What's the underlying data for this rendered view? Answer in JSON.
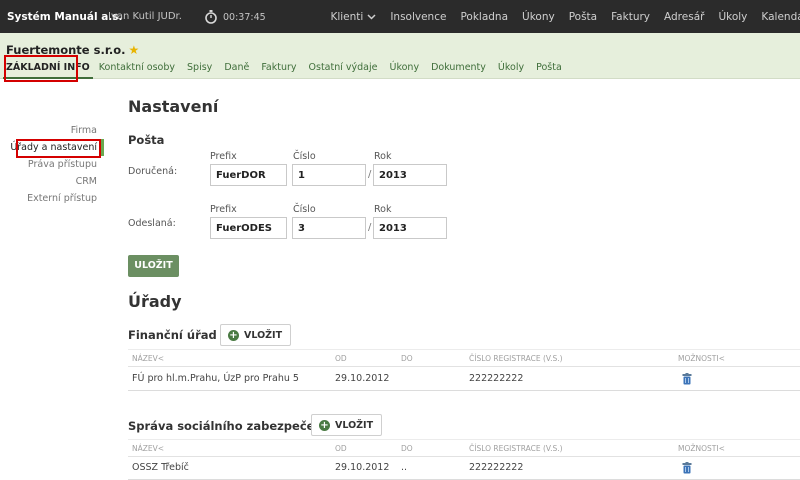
{
  "topbar": {
    "brand": "Systém Manuál a.s.",
    "user": "Ivan Kutil JUDr.",
    "timer": "00:37:45",
    "nav": [
      "Klienti",
      "Insolvence",
      "Pokladna",
      "Úkony",
      "Pošta",
      "Faktury",
      "Adresář",
      "Úkoly",
      "Kalendář"
    ]
  },
  "company": {
    "name": "Fuertemonte s.r.o.",
    "tabs": [
      "ZÁKLADNÍ INFO",
      "Kontaktní osoby",
      "Spisy",
      "Daně",
      "Faktury",
      "Ostatní výdaje",
      "Úkony",
      "Dokumenty",
      "Úkoly",
      "Pošta"
    ]
  },
  "left_menu": [
    "Firma",
    "Úřady a nastavení",
    "Práva přístupu",
    "CRM",
    "Externí přístup"
  ],
  "settings": {
    "title": "Nastavení",
    "section": "Pošta",
    "col_prefix": "Prefix",
    "col_number": "Číslo",
    "col_year": "Rok",
    "received_label": "Doručená:",
    "received": {
      "prefix": "FuerDOR",
      "number": "1",
      "year": "2013"
    },
    "sent_label": "Odeslaná:",
    "sent": {
      "prefix": "FuerODES",
      "number": "3",
      "year": "2013"
    },
    "slash": "/",
    "save_button": "ULOŽIT"
  },
  "offices": {
    "title": "Úřady",
    "add_label": "VLOŽIT",
    "columns": [
      "NÁZEV<",
      "OD",
      "DO",
      "ČÍSLO REGISTRACE (V.S.)",
      "MOŽNOSTI<"
    ],
    "sections": [
      {
        "title": "Finanční úřad",
        "rows": [
          {
            "name": "FÚ pro hl.m.Prahu, ÚzP pro Prahu 5",
            "from": "29.10.2012",
            "to": "",
            "reg": "222222222"
          }
        ]
      },
      {
        "title": "Správa sociálního zabezpečení",
        "rows": [
          {
            "name": "OSSZ Třebíč",
            "from": "29.10.2012",
            "to": "..",
            "reg": "222222222"
          }
        ]
      }
    ]
  },
  "colors": {
    "accent": "#6b8f62",
    "header_bg": "#e6efdc",
    "topbar_bg": "#2b2b2b",
    "highlight": "#d40000"
  }
}
